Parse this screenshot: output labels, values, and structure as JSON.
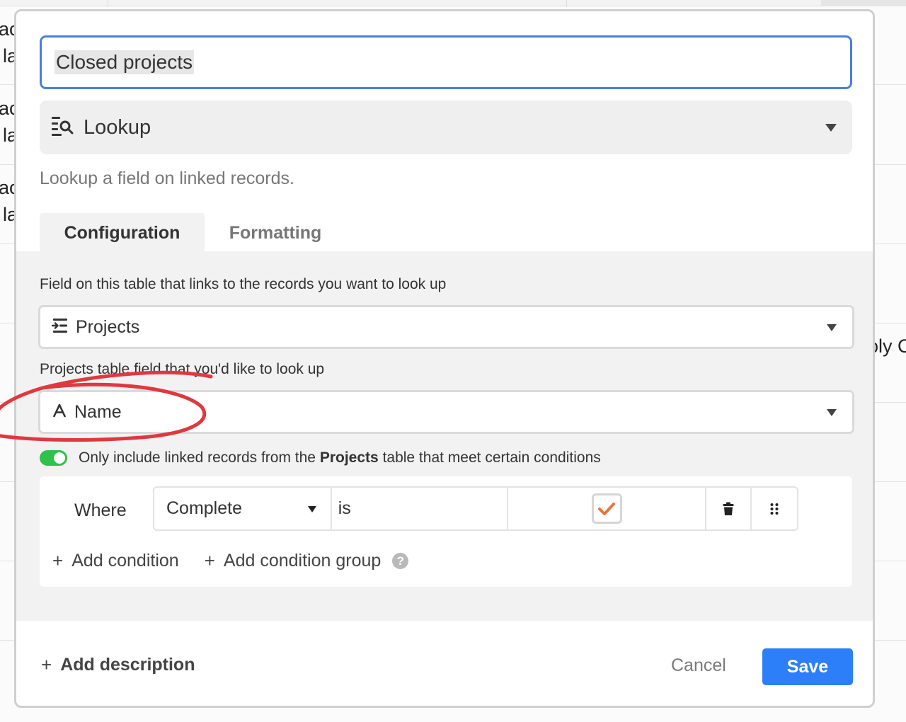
{
  "background": {
    "fragments": [
      "ac",
      "la",
      "ac",
      "la",
      "ac",
      "la",
      "oly C"
    ]
  },
  "dialog": {
    "field_name_value": "Closed projects",
    "field_type": {
      "icon": "lookup-icon",
      "label": "Lookup"
    },
    "type_description": "Lookup a field on linked records.",
    "tabs": [
      {
        "label": "Configuration",
        "active": true
      },
      {
        "label": "Formatting",
        "active": false
      }
    ],
    "config": {
      "link_field_label": "Field on this table that links to the records you want to look up",
      "link_field_value": "Projects",
      "link_field_icon": "linked-record-icon",
      "lookup_field_label": "Projects table field that you'd like to look up",
      "lookup_field_value": "Name",
      "lookup_field_icon": "text-field-icon",
      "condition_toggle": {
        "on": true,
        "text_before": "Only include linked records from the",
        "table_name": "Projects",
        "text_after": "table that meet certain conditions"
      },
      "condition": {
        "where_label": "Where",
        "field": "Complete",
        "operator": "is",
        "value_checked": true
      },
      "add_condition_label": "Add condition",
      "add_condition_group_label": "Add condition group"
    },
    "footer": {
      "add_description_label": "Add description",
      "cancel_label": "Cancel",
      "save_label": "Save"
    }
  },
  "colors": {
    "accent_blue": "#2d7ff9",
    "input_focus_border": "#4a7fd8",
    "toggle_green": "#2fc14a",
    "checkmark_orange": "#e8743b",
    "annotation_red": "#e0383e"
  }
}
